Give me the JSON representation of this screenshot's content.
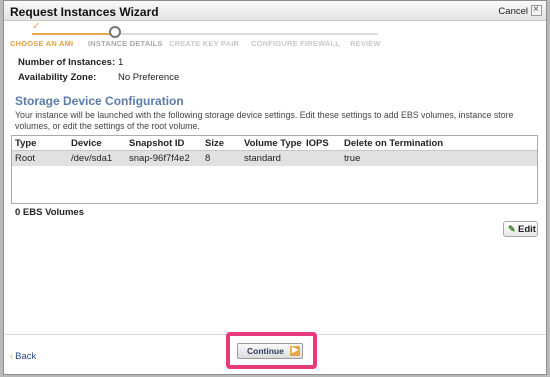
{
  "window": {
    "title": "Request Instances Wizard",
    "cancel_label": "Cancel",
    "close_glyph": "×"
  },
  "steps": [
    {
      "label": "CHOOSE AN AMI",
      "state": "done"
    },
    {
      "label": "INSTANCE DETAILS",
      "state": "current"
    },
    {
      "label": "CREATE KEY PAIR",
      "state": "pending"
    },
    {
      "label": "CONFIGURE FIREWALL",
      "state": "pending"
    },
    {
      "label": "REVIEW",
      "state": "pending"
    }
  ],
  "details": {
    "instances_label": "Number of Instances:",
    "instances_value": "1",
    "zone_label": "Availability Zone:",
    "zone_value": "No Preference"
  },
  "storage": {
    "title": "Storage Device Configuration",
    "description": "Your instance will be launched with the following storage device settings. Edit these settings to add EBS volumes, instance store volumes, or edit the settings of the root volume.",
    "columns": [
      "Type",
      "Device",
      "Snapshot ID",
      "Size",
      "Volume Type",
      "IOPS",
      "Delete on Termination"
    ],
    "rows": [
      [
        "Root",
        "/dev/sda1",
        "snap-96f7f4e2",
        "8",
        "standard",
        "",
        "true"
      ]
    ],
    "ebs_count": "0 EBS Volumes",
    "edit_label": "Edit"
  },
  "footer": {
    "back_label": "Back",
    "continue_label": "Continue"
  },
  "colors": {
    "accent_orange": "#e8a54a",
    "section_blue": "#5b7ba8",
    "highlight_pink": "#e8397a"
  },
  "icons": {
    "done_step": "check-icon",
    "edit": "pencil-icon",
    "continue": "arrow-right-icon",
    "back": "chevron-left-icon"
  }
}
